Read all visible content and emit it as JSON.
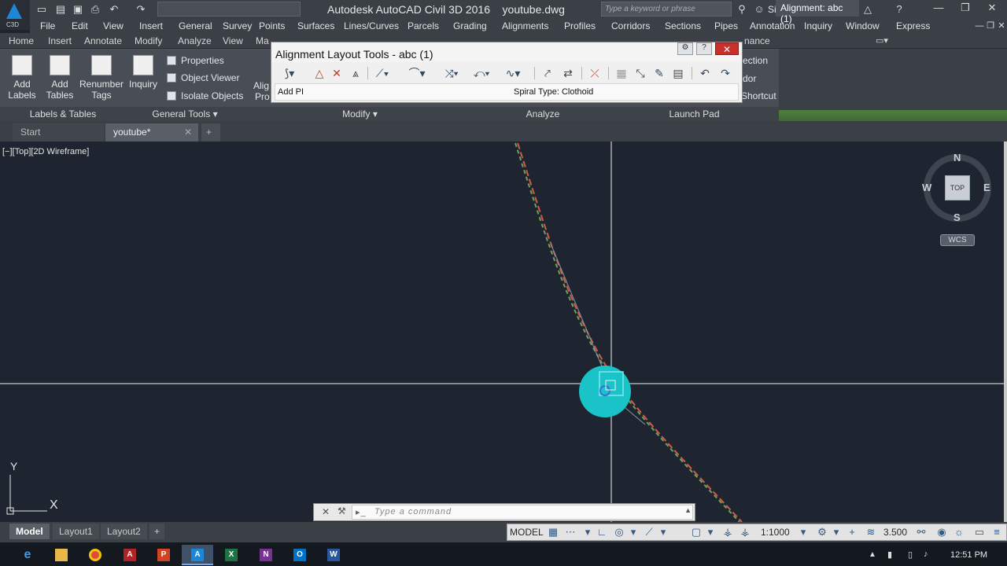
{
  "app": {
    "title": "Autodesk AutoCAD Civil 3D 2016    youtube.dwg",
    "logo_label": "C3D",
    "search_placeholder": "Type a keyword or phrase",
    "sign_in": "Sign In"
  },
  "menubar": [
    "File",
    "Edit",
    "View",
    "Insert",
    "General",
    "Survey",
    "Points",
    "Surfaces",
    "Lines/Curves",
    "Parcels",
    "Grading",
    "Alignments",
    "Profiles",
    "Corridors",
    "Sections",
    "Pipes",
    "Annotation",
    "Inquiry",
    "Window",
    "Express"
  ],
  "ribbon_tabs": [
    "Home",
    "Insert",
    "Annotate",
    "Modify",
    "Analyze",
    "View",
    "Ma"
  ],
  "ribbon_tab_right": "nance",
  "ribbon_tab_active": "Alignment: abc (1)",
  "ribbon": {
    "add_labels": "Add\nLabels",
    "add_tables": "Add\nTables",
    "renumber_tags": "Renumber\nTags",
    "inquiry": "Inquiry",
    "properties": "Properties",
    "object_viewer": "Object Viewer",
    "isolate_objects": "Isolate Objects",
    "align_partial_1": "Alig",
    "align_partial_2": "Pro",
    "right_partial_1": "ection",
    "right_partial_2": "dor",
    "right_partial_3": "Shortcut",
    "panel_labels_tables": "Labels & Tables",
    "panel_general_tools": "General Tools",
    "panel_modify": "Modify",
    "panel_analyze": "Analyze",
    "panel_launch_pad": "Launch Pad"
  },
  "alignment_tools": {
    "title": "Alignment Layout Tools - abc (1)",
    "status_left": "Add PI",
    "status_right": "Spiral Type: Clothoid",
    "icons": [
      "tangent-tangent-icon",
      "insert-pi-icon",
      "delete-pi-icon",
      "break-apart-pi-icon",
      "fixed-line-icon",
      "fixed-curve-icon",
      "floating-icon",
      "free-curve-icon",
      "spiral-icon",
      "convert-line-icon",
      "reverse-icon",
      "delete-sub-entity-icon",
      "edit-best-fit-icon",
      "pick-sub-entity-icon",
      "sub-entity-editor-icon",
      "grid-view-icon",
      "undo-icon",
      "redo-icon"
    ]
  },
  "file_tabs": {
    "start": "Start",
    "active": "youtube*"
  },
  "viewport": {
    "label": "[−][Top][2D Wireframe]",
    "viewcube_top": "TOP",
    "n": "N",
    "s": "S",
    "e": "E",
    "w": "W",
    "wcs": "WCS",
    "ucs_x": "X",
    "ucs_y": "Y"
  },
  "command": {
    "placeholder": "Type  a  command"
  },
  "layout_tabs": [
    "Model",
    "Layout1",
    "Layout2"
  ],
  "status": {
    "model": "MODEL",
    "scale": "1:1000",
    "elevation": "3.500"
  },
  "clock": "12:51 PM",
  "colors": {
    "accent": "#1d86d6",
    "grip": "#19c3c7",
    "alignment_red": "#d35a4a",
    "alignment_green": "#6fa25a"
  }
}
